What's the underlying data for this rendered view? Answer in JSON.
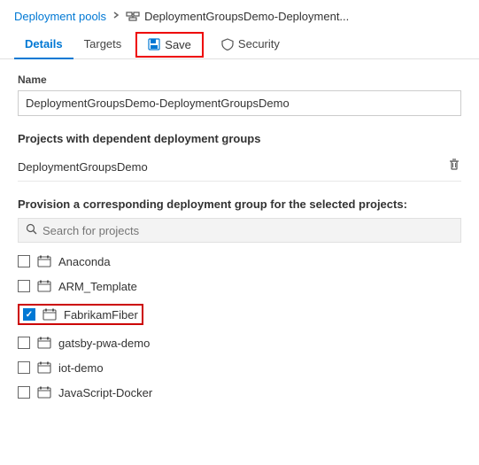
{
  "breadcrumb": {
    "link_label": "Deployment pools",
    "separator": ">",
    "current_label": "DeploymentGroupsDemo-Deployment..."
  },
  "tabs": {
    "details_label": "Details",
    "targets_label": "Targets",
    "save_label": "Save",
    "security_label": "Security"
  },
  "name_field": {
    "label": "Name",
    "value": "DeploymentGroupsDemo-DeploymentGroupsDemo"
  },
  "dependent_section": {
    "title": "Projects with dependent deployment groups",
    "project": "DeploymentGroupsDemo"
  },
  "provision_section": {
    "label": "Provision a corresponding deployment group for the selected projects:",
    "search_placeholder": "Search for projects"
  },
  "projects": [
    {
      "name": "Anaconda",
      "checked": false,
      "highlighted": false
    },
    {
      "name": "ARM_Template",
      "checked": false,
      "highlighted": false
    },
    {
      "name": "FabrikamFiber",
      "checked": true,
      "highlighted": true
    },
    {
      "name": "gatsby-pwa-demo",
      "checked": false,
      "highlighted": false
    },
    {
      "name": "iot-demo",
      "checked": false,
      "highlighted": false
    },
    {
      "name": "JavaScript-Docker",
      "checked": false,
      "highlighted": false
    }
  ]
}
